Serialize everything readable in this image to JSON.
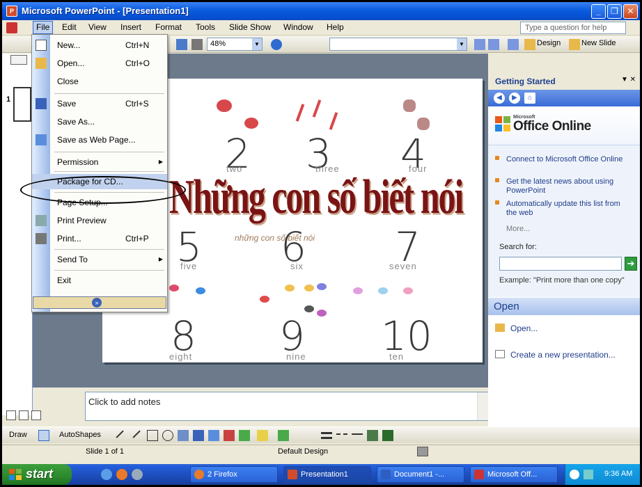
{
  "window": {
    "title": "Microsoft PowerPoint - [Presentation1]"
  },
  "menubar": {
    "items": [
      "File",
      "Edit",
      "View",
      "Insert",
      "Format",
      "Tools",
      "Slide Show",
      "Window",
      "Help"
    ],
    "ask_placeholder": "Type a question for help"
  },
  "toolbar": {
    "zoom": "48%",
    "design_label": "Design",
    "new_slide_label": "New Slide"
  },
  "file_menu": {
    "items": [
      {
        "label": "New...",
        "shortcut": "Ctrl+N"
      },
      {
        "label": "Open...",
        "shortcut": "Ctrl+O"
      },
      {
        "label": "Close",
        "shortcut": ""
      },
      {
        "label": "Save",
        "shortcut": "Ctrl+S"
      },
      {
        "label": "Save As...",
        "shortcut": ""
      },
      {
        "label": "Save as Web Page...",
        "shortcut": ""
      },
      {
        "label": "Permission",
        "shortcut": ""
      },
      {
        "label": "Package for CD...",
        "shortcut": ""
      },
      {
        "label": "Page Setup...",
        "shortcut": ""
      },
      {
        "label": "Print Preview",
        "shortcut": ""
      },
      {
        "label": "Print...",
        "shortcut": "Ctrl+P"
      },
      {
        "label": "Send To",
        "shortcut": ""
      },
      {
        "label": "Exit",
        "shortcut": ""
      }
    ]
  },
  "outline": {
    "slide_number": "1"
  },
  "slide": {
    "numbers": [
      "2",
      "3",
      "4",
      "5",
      "6",
      "7",
      "8",
      "9",
      "10"
    ],
    "words": [
      "two",
      "three",
      "four",
      "five",
      "six",
      "seven",
      "eight",
      "nine",
      "ten"
    ],
    "wordart": "Những con số biết nói",
    "wordart_shadow": "những con số biết nói"
  },
  "notes": {
    "placeholder": "Click to add notes"
  },
  "taskpane": {
    "title": "Getting Started",
    "logo_small": "Microsoft",
    "logo_text": "Office Online",
    "links": [
      "Connect to Microsoft Office Online",
      "Get the latest news about using PowerPoint",
      "Automatically update this list from the web"
    ],
    "more": "More...",
    "search_label": "Search for:",
    "search_example": "Example:  \"Print more than one copy\"",
    "open_heading": "Open",
    "open_link": "Open...",
    "create_link": "Create a new presentation..."
  },
  "drawbar": {
    "draw_label": "Draw",
    "autoshapes_label": "AutoShapes"
  },
  "status": {
    "slide": "Slide 1 of 1",
    "design": "Default Design"
  },
  "taskbar": {
    "start": "start",
    "tasks": [
      "2 Firefox",
      "Presentation1",
      "Document1 -...",
      "Microsoft Off..."
    ],
    "clock": "9:36 AM"
  },
  "colors": {
    "title_bar": "#0A5BDE",
    "wordart": "#7A1414",
    "start": "#2C8A2C",
    "taskpane_link": "#1F3C88"
  }
}
